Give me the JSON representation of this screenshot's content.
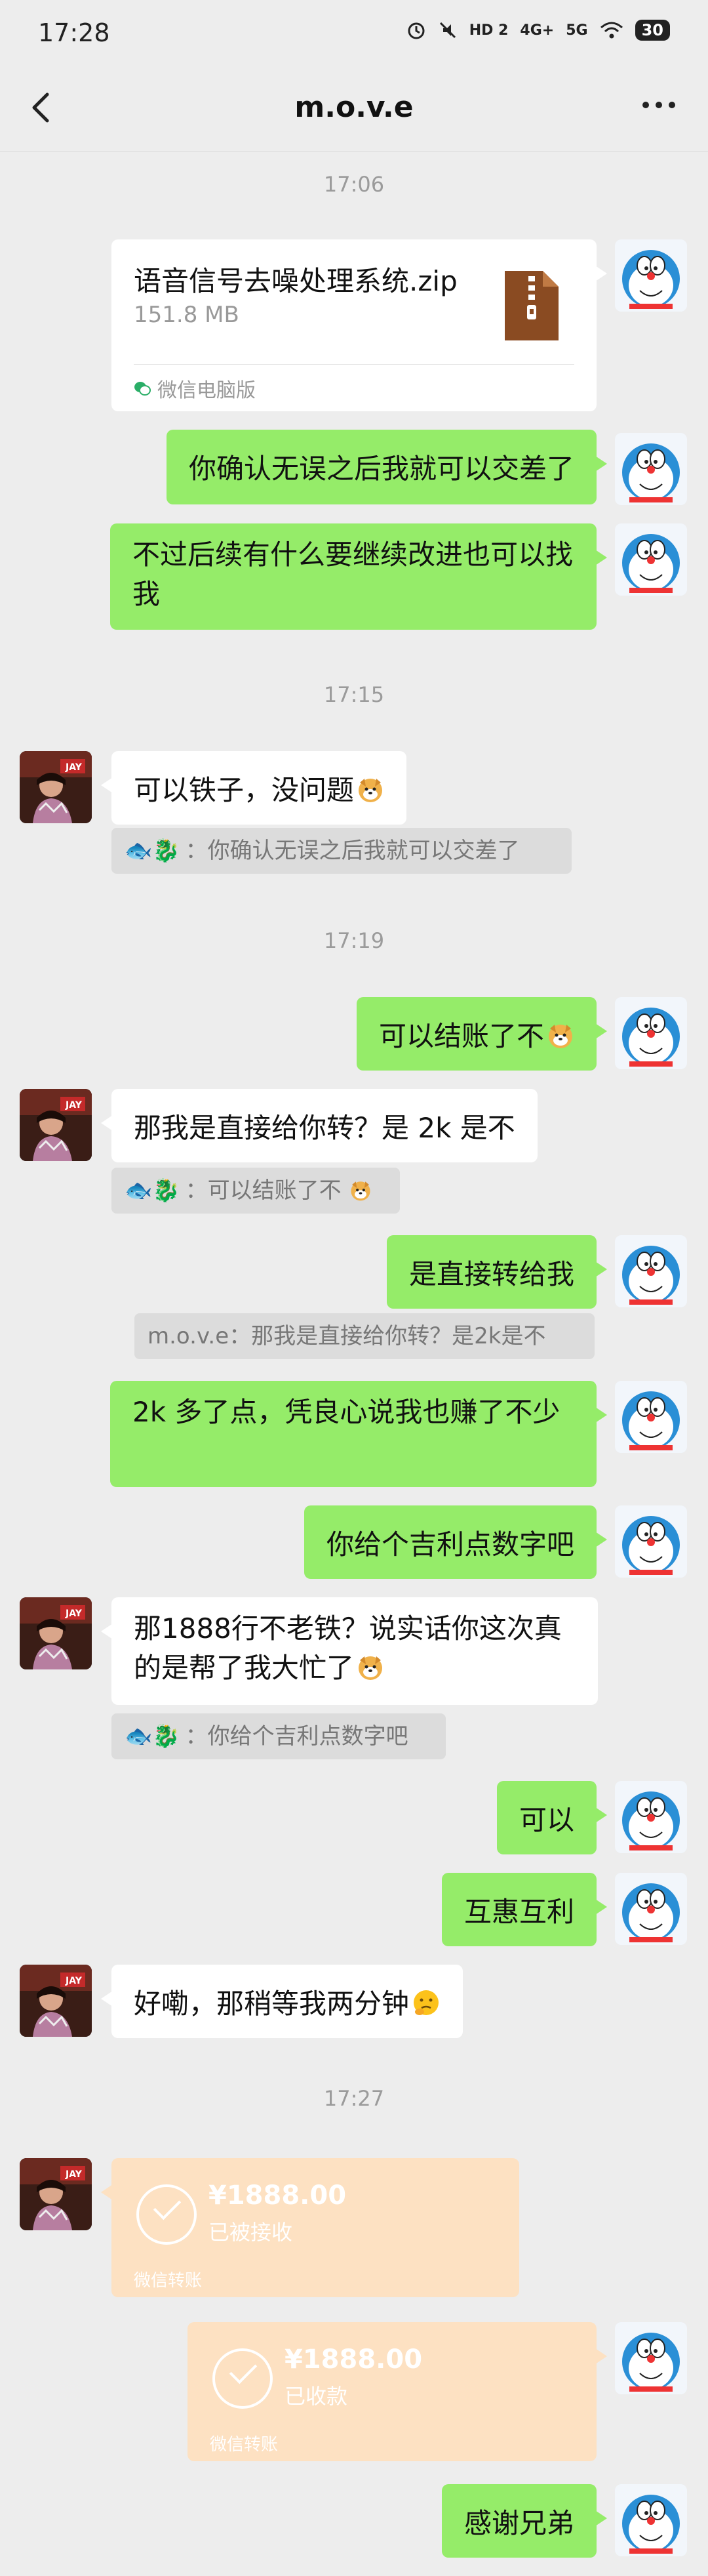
{
  "status_bar": {
    "time": "17:28",
    "network1": "HD 2",
    "network2": "4G+",
    "network3": "5G",
    "battery": "30"
  },
  "nav": {
    "title": "m.o.v.e"
  },
  "timestamps": [
    "17:06",
    "17:15",
    "17:19",
    "17:27"
  ],
  "file": {
    "name": "语音信号去噪处理系统.zip",
    "size": "151.8 MB",
    "source": "微信电脑版"
  },
  "messages": {
    "m1": "你确认无误之后我就可以交差了",
    "m2": "不过后续有什么要继续改进也可以找我",
    "m3": "可以铁子，没问题",
    "q3_who": "🐟🐉",
    "q3": "：你确认无误之后我就可以交差了",
    "m4": "可以结账了不",
    "m5": "那我是直接给你转？是 2k 是不",
    "q5_who": "🐟🐉",
    "q5": "：可以结账了不",
    "m6": "是直接转给我",
    "q6": "m.o.v.e：那我是直接给你转？是2k是不",
    "m7": "2k 多了点，凭良心说我也赚了不少",
    "m8": "你给个吉利点数字吧",
    "m9": "那1888行不老铁？说实话你这次真的是帮了我大忙了",
    "q9_who": "🐟🐉",
    "q9": "：你给个吉利点数字吧",
    "m10": "可以",
    "m11": "互惠互利",
    "m12": "好嘞，那稍等我两分钟",
    "m13": "感谢兄弟"
  },
  "transfers": {
    "t1": {
      "amount": "¥1888.00",
      "status": "已被接收",
      "source": "微信转账"
    },
    "t2": {
      "amount": "¥1888.00",
      "status": "已收款",
      "source": "微信转账"
    }
  },
  "colors": {
    "background": "#ededed",
    "my_bubble": "#95ec69",
    "their_bubble": "#ffffff",
    "transfer": "#fde1c2"
  },
  "icons": [
    "back-arrow-icon",
    "more-dots-icon",
    "zip-file-icon",
    "doraemon-avatar",
    "jay-avatar",
    "dog-emoji-icon",
    "thinking-emoji-icon",
    "check-circle-icon"
  ]
}
